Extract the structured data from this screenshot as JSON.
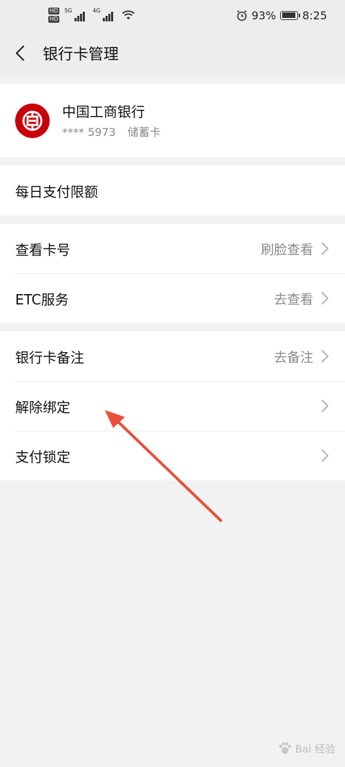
{
  "status_bar": {
    "hd_badges": [
      "HD",
      "HD"
    ],
    "signal_tags": [
      "5G",
      "4G"
    ],
    "battery_percent": "93%",
    "battery_level": 0.93,
    "time": "8:25",
    "icons": [
      "alarm-icon",
      "wifi-icon",
      "battery-icon"
    ]
  },
  "nav": {
    "title": "银行卡管理",
    "back_icon": "chevron-left-icon"
  },
  "card": {
    "bank_name": "中国工商银行",
    "card_number_masked": "**** 5973",
    "card_type": "储蓄卡",
    "logo_icon": "icbc-logo",
    "brand_color": "#c7000b"
  },
  "groups": [
    {
      "rows": [
        {
          "label": "每日支付限额",
          "value": "",
          "chevron": false
        }
      ]
    },
    {
      "rows": [
        {
          "label": "查看卡号",
          "value": "刷脸查看",
          "chevron": true
        },
        {
          "label": "ETC服务",
          "value": "去查看",
          "chevron": true
        }
      ]
    },
    {
      "rows": [
        {
          "label": "银行卡备注",
          "value": "去备注",
          "chevron": true
        },
        {
          "label": "解除绑定",
          "value": "",
          "chevron": true
        },
        {
          "label": "支付锁定",
          "value": "",
          "chevron": true
        }
      ]
    }
  ],
  "annotation": {
    "arrow_color": "#e8503a",
    "icon": "red-arrow-annotation"
  },
  "watermark": {
    "text": "Bai 经验"
  }
}
